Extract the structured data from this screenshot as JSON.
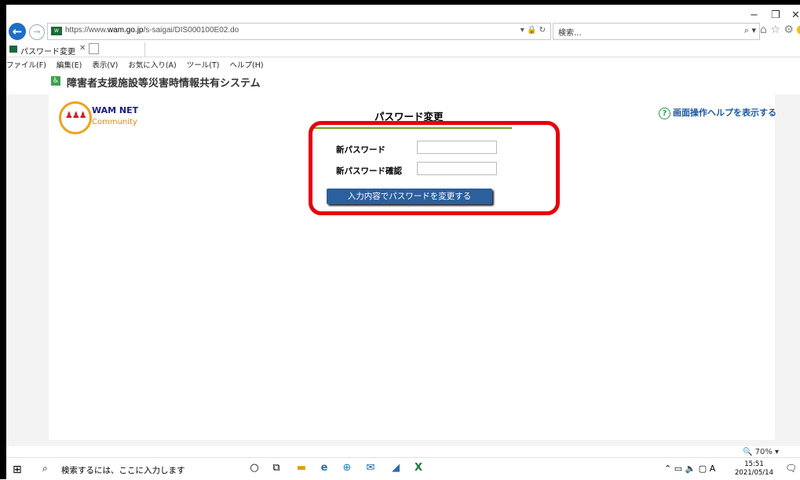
{
  "browser": {
    "url_prefix": "https://www.",
    "url_domain": "wam.go.jp",
    "url_path": "/s-saigai/DIS000100E02.do",
    "search_placeholder": "検索...",
    "tab_title": "パスワード変更",
    "window_controls": [
      "−",
      "❐",
      "✕"
    ]
  },
  "menu": [
    "ファイル(F)",
    "編集(E)",
    "表示(V)",
    "お気に入り(A)",
    "ツール(T)",
    "ヘルプ(H)"
  ],
  "system_title": "障害者支援施設等災害時情報共有システム",
  "logo": {
    "name": "WAM NET",
    "sub": "Community"
  },
  "page": {
    "title": "パスワード変更",
    "help_link": "画面操作ヘルプを表示する",
    "new_password_label": "新パスワード",
    "confirm_password_label": "新パスワード確認",
    "new_password_value": "",
    "confirm_password_value": "",
    "submit_label": "入力内容でパスワードを変更する"
  },
  "status": {
    "zoom": "70%"
  },
  "taskbar": {
    "search_placeholder": "検索するには、ここに入力します",
    "ime_indicator": "A",
    "time": "15:51",
    "date": "2021/05/14"
  },
  "colors": {
    "highlight": "#e8000a",
    "button": "#2b5f9e",
    "help_link": "#1a5aa0"
  }
}
